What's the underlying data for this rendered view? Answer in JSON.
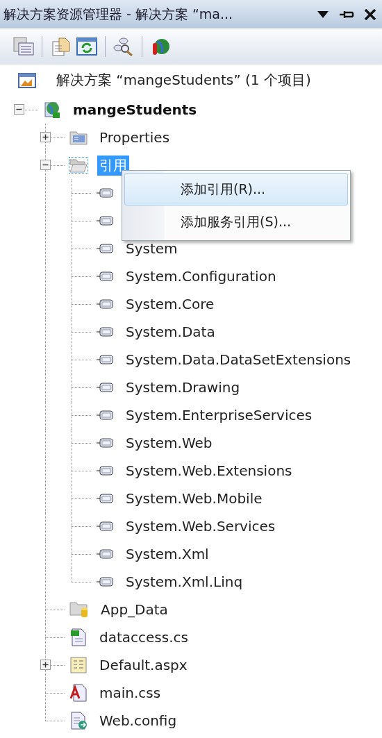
{
  "window": {
    "title": "解决方案资源管理器 - 解决方案 “ma..."
  },
  "solution": {
    "label": "解决方案 “mangeStudents” (1 个项目)"
  },
  "tree": [
    {
      "kind": "project",
      "label": "mangeStudents",
      "expanded": true,
      "selected": false,
      "children": [
        {
          "kind": "properties",
          "label": "Properties",
          "expanded": false,
          "selected": false
        },
        {
          "kind": "references",
          "label": "引用",
          "expanded": true,
          "selected": true,
          "children": [
            {
              "kind": "reference",
              "selected": false
            },
            {
              "kind": "reference",
              "selected": false
            },
            {
              "kind": "reference",
              "label": "System",
              "selected": false
            },
            {
              "kind": "reference",
              "label": "System.Configuration",
              "selected": false
            },
            {
              "kind": "reference",
              "label": "System.Core",
              "selected": false
            },
            {
              "kind": "reference",
              "label": "System.Data",
              "selected": false
            },
            {
              "kind": "reference",
              "label": "System.Data.DataSetExtensions",
              "selected": false
            },
            {
              "kind": "reference",
              "label": "System.Drawing",
              "selected": false
            },
            {
              "kind": "reference",
              "label": "System.EnterpriseServices",
              "selected": false
            },
            {
              "kind": "reference",
              "label": "System.Web",
              "selected": false
            },
            {
              "kind": "reference",
              "label": "System.Web.Extensions",
              "selected": false
            },
            {
              "kind": "reference",
              "label": "System.Web.Mobile",
              "selected": false
            },
            {
              "kind": "reference",
              "label": "System.Web.Services",
              "selected": false
            },
            {
              "kind": "reference",
              "label": "System.Xml",
              "selected": false
            },
            {
              "kind": "reference",
              "label": "System.Xml.Linq",
              "selected": false
            }
          ]
        },
        {
          "kind": "data-folder",
          "label": "App_Data",
          "selected": false
        },
        {
          "kind": "cs",
          "label": "dataccess.cs",
          "selected": false
        },
        {
          "kind": "aspx",
          "label": "Default.aspx",
          "expanded": false,
          "selected": false
        },
        {
          "kind": "css",
          "label": "main.css",
          "selected": false
        },
        {
          "kind": "config",
          "label": "Web.config",
          "selected": false
        }
      ]
    }
  ],
  "context_menu": {
    "items": [
      {
        "label": "添加引用(R)...",
        "selected": true
      },
      {
        "label": "添加服务引用(S)...",
        "selected": false
      }
    ]
  }
}
